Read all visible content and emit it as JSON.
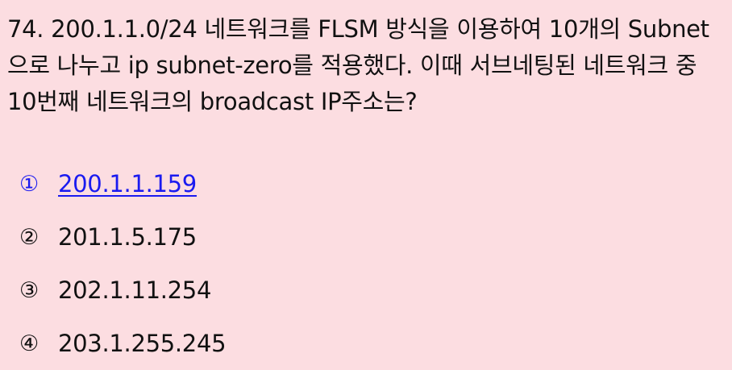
{
  "question": {
    "text": "74. 200.1.1.0/24 네트워크를 FLSM 방식을 이용하여 10개의 Subnet으로 나누고 ip subnet-zero를 적용했다. 이때 서브네팅된 네트워크 중 10번째 네트워크의 broadcast IP주소는?"
  },
  "options": [
    {
      "marker": "①",
      "text": "200.1.1.159"
    },
    {
      "marker": "②",
      "text": "201.1.5.175"
    },
    {
      "marker": "③",
      "text": "202.1.11.254"
    },
    {
      "marker": "④",
      "text": "203.1.255.245"
    }
  ],
  "colors": {
    "background": "#fcdde1",
    "text": "#111111",
    "selected_option": "#1a1af0"
  }
}
